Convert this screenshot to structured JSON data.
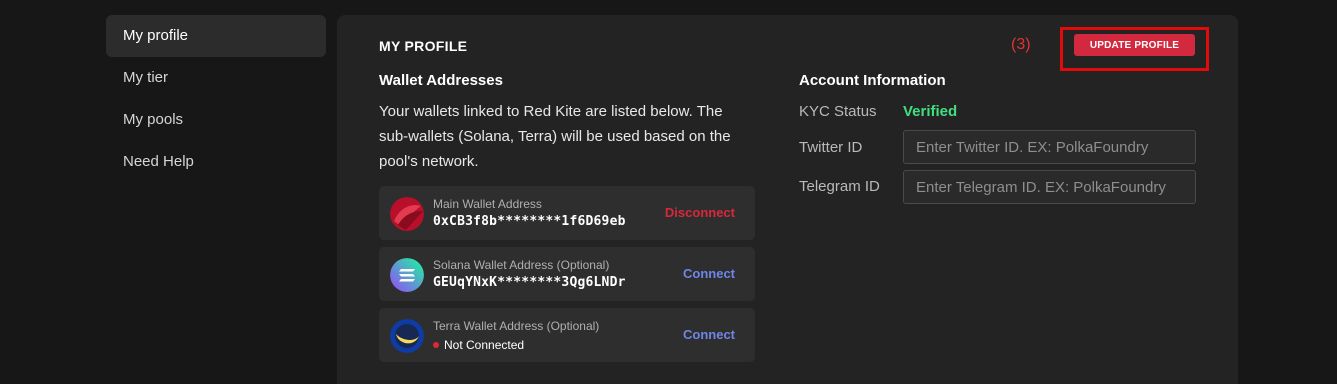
{
  "sidebar": {
    "items": [
      {
        "label": "My profile"
      },
      {
        "label": "My tier"
      },
      {
        "label": "My pools"
      },
      {
        "label": "Need Help"
      }
    ]
  },
  "main": {
    "title": "MY PROFILE",
    "annotation": "(3)",
    "update_button_label": "UPDATE PROFILE",
    "wallet_section": {
      "title": "Wallet Addresses",
      "description": "Your wallets linked to Red Kite are listed below. The sub-wallets (Solana, Terra) will be used based on the pool's network.",
      "wallets": [
        {
          "label": "Main Wallet Address",
          "value": "0xCB3f8b********1f6D69eb",
          "action": "Disconnect",
          "icon": "red-kite-icon",
          "action_color": "#d7283c"
        },
        {
          "label": "Solana Wallet Address (Optional)",
          "value": "GEUqYNxK********3Qg6LNDr",
          "action": "Connect",
          "icon": "solana-icon",
          "action_color": "#6f86e8"
        },
        {
          "label": "Terra Wallet Address (Optional)",
          "value": "Not Connected",
          "action": "Connect",
          "icon": "terra-icon",
          "action_color": "#6f86e8"
        }
      ]
    },
    "account_section": {
      "title": "Account Information",
      "kyc_label": "KYC Status",
      "kyc_value": "Verified",
      "twitter_label": "Twitter ID",
      "twitter_placeholder": "Enter Twitter ID. EX: PolkaFoundry",
      "twitter_value": "",
      "telegram_label": "Telegram ID",
      "telegram_placeholder": "Enter Telegram ID. EX: PolkaFoundry",
      "telegram_value": ""
    }
  },
  "colors": {
    "accent": "#d2293f",
    "verified": "#40e080",
    "connect": "#6f86e8",
    "annotation": "#e53131"
  }
}
